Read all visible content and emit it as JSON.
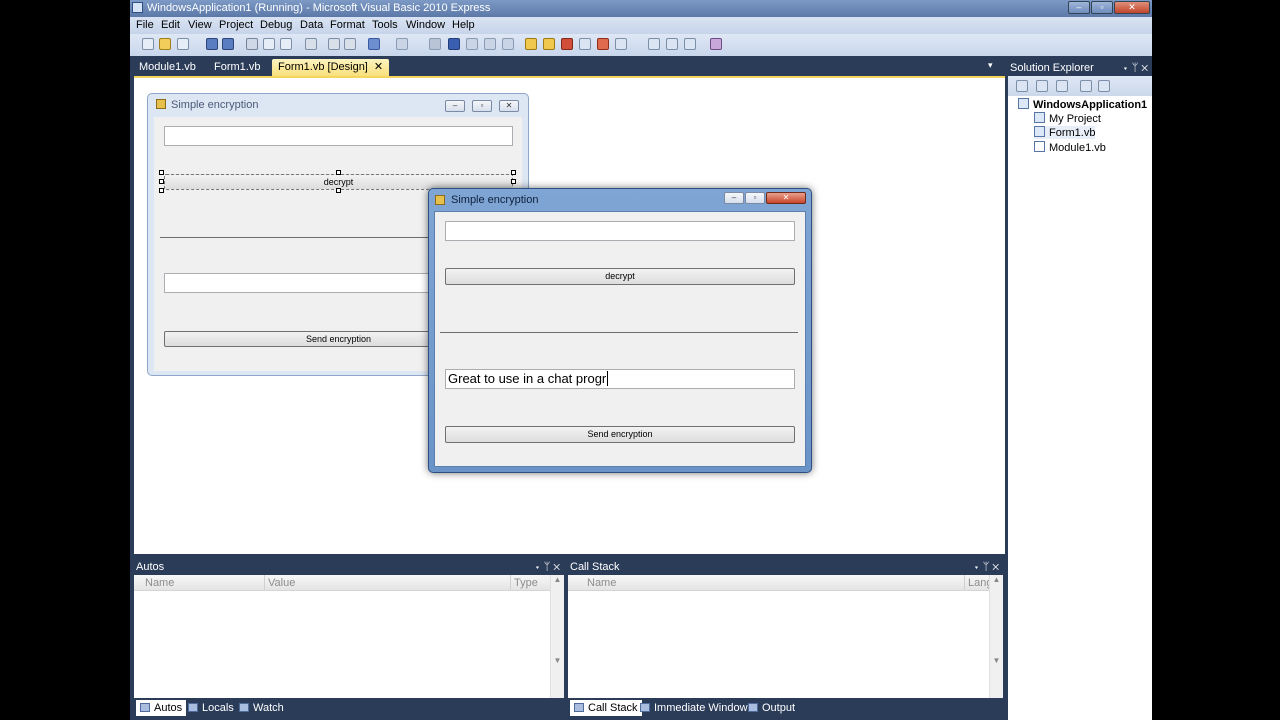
{
  "window": {
    "title": "WindowsApplication1 (Running) - Microsoft Visual Basic 2010 Express",
    "minimize": "–",
    "restore": "▫",
    "close": "✕"
  },
  "menu": [
    "File",
    "Edit",
    "View",
    "Project",
    "Debug",
    "Data",
    "Format",
    "Tools",
    "Window",
    "Help"
  ],
  "tabs": [
    {
      "label": "Module1.vb"
    },
    {
      "label": "Form1.vb"
    },
    {
      "label": "Form1.vb [Design]",
      "close": "✕"
    }
  ],
  "tab_dropdown": "▾",
  "design_form": {
    "title": "Simple encryption",
    "decrypt_label": "decrypt",
    "send_label": "Send encryption"
  },
  "running_form": {
    "title": "Simple encryption",
    "decrypt_label": "decrypt",
    "send_label": "Send encryption",
    "message_value": "Great to use in a chat progr"
  },
  "solution_explorer": {
    "title": "Solution Explorer",
    "pin": "▾ ᛘ ✕",
    "items": [
      "WindowsApplication1",
      "My Project",
      "Form1.vb",
      "Module1.vb"
    ]
  },
  "autos": {
    "title": "Autos",
    "pin": "▾ ᛘ ✕",
    "columns": [
      "Name",
      "Value",
      "Type"
    ]
  },
  "callstack": {
    "title": "Call Stack",
    "pin": "▾ ᛘ ✕",
    "columns": [
      "Name",
      "Lang"
    ]
  },
  "bottom_tabs_left": [
    "Autos",
    "Locals",
    "Watch"
  ],
  "bottom_tabs_right": [
    "Call Stack",
    "Immediate Window",
    "Output"
  ]
}
